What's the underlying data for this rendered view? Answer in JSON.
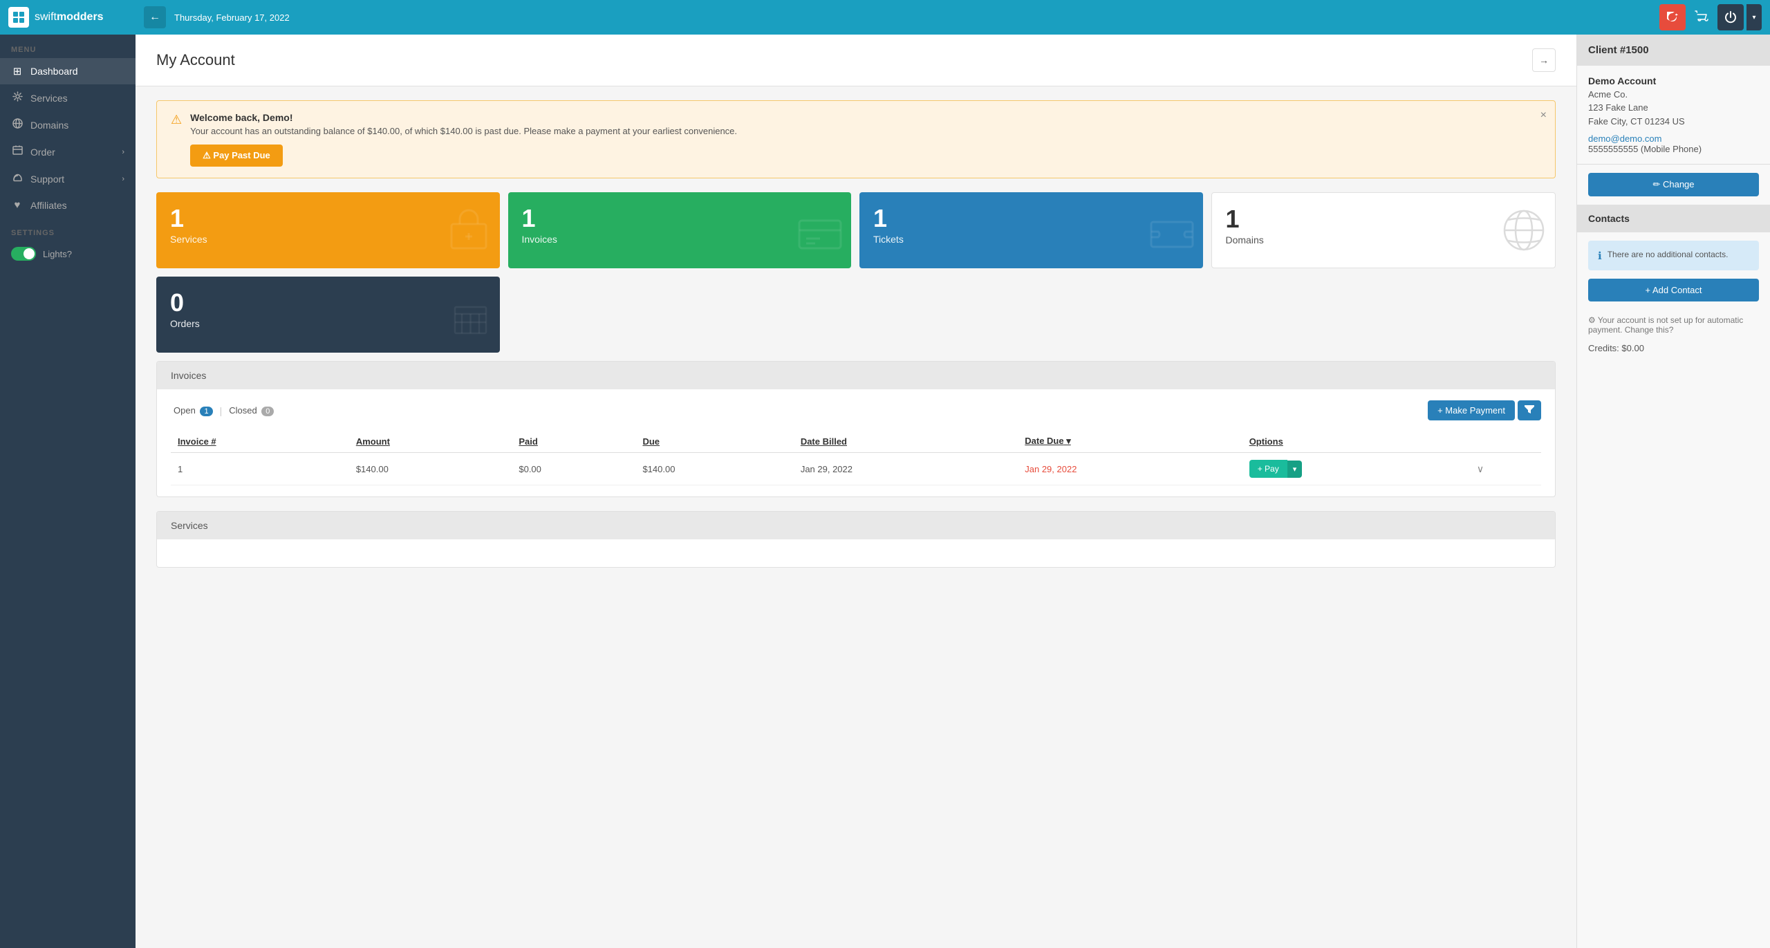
{
  "brand": {
    "name_prefix": "swift",
    "name_suffix": "modders"
  },
  "topbar": {
    "date": "Thursday, February 17, 2022",
    "back_label": "←"
  },
  "sidebar": {
    "menu_label": "MENU",
    "items": [
      {
        "id": "dashboard",
        "label": "Dashboard",
        "icon": "⊞",
        "active": true
      },
      {
        "id": "services",
        "label": "Services",
        "icon": "🔧",
        "active": false
      },
      {
        "id": "domains",
        "label": "Domains",
        "icon": "🌐",
        "active": false
      },
      {
        "id": "order",
        "label": "Order",
        "icon": "🛒",
        "active": false,
        "arrow": "›"
      },
      {
        "id": "support",
        "label": "Support",
        "icon": "💬",
        "active": false,
        "arrow": "›"
      },
      {
        "id": "affiliates",
        "label": "Affiliates",
        "icon": "❤",
        "active": false
      }
    ],
    "settings_label": "SETTINGS",
    "lights_label": "Lights?"
  },
  "page": {
    "title": "My Account"
  },
  "alert": {
    "title": "Welcome back, Demo!",
    "body": "Your account has an outstanding balance of $140.00, of which $140.00 is past due. Please make a payment at your earliest convenience.",
    "pay_button": "⚠ Pay Past Due"
  },
  "stats": [
    {
      "id": "services",
      "number": "1",
      "label": "Services",
      "color": "yellow",
      "icon": "🎁"
    },
    {
      "id": "invoices",
      "number": "1",
      "label": "Invoices",
      "color": "green",
      "icon": "💳"
    },
    {
      "id": "tickets",
      "number": "1",
      "label": "Tickets",
      "color": "blue",
      "icon": "🖥"
    },
    {
      "id": "domains",
      "number": "1",
      "label": "Domains",
      "color": "light",
      "icon": "🌐"
    },
    {
      "id": "orders",
      "number": "0",
      "label": "Orders",
      "color": "dark",
      "icon": "🛒"
    }
  ],
  "invoices_section": {
    "header": "Invoices",
    "tab_open": "Open",
    "tab_open_count": "1",
    "tab_closed": "Closed",
    "tab_closed_count": "0",
    "make_payment_label": "+ Make Payment",
    "columns": [
      "Invoice #",
      "Amount",
      "Paid",
      "Due",
      "Date Billed",
      "Date Due",
      "Options"
    ],
    "rows": [
      {
        "invoice_num": "1",
        "amount": "$140.00",
        "paid": "$0.00",
        "due": "$140.00",
        "date_billed": "Jan 29, 2022",
        "date_due": "Jan 29, 2022",
        "date_due_overdue": true,
        "pay_label": "+ Pay"
      }
    ]
  },
  "services_section": {
    "header": "Services"
  },
  "right_panel": {
    "client_header": "Client #1500",
    "name": "Demo Account",
    "company": "Acme Co.",
    "address_line1": "123 Fake Lane",
    "address_line2": "Fake City, CT 01234 US",
    "email": "demo@demo.com",
    "phone": "5555555555 (Mobile Phone)",
    "change_button": "✏ Change",
    "contacts_header": "Contacts",
    "no_contacts_text": "There are no additional contacts.",
    "add_contact_button": "+ Add Contact",
    "autopay_text": "Your account is not set up for automatic payment. Change this?",
    "credits_text": "Credits: $0.00"
  }
}
